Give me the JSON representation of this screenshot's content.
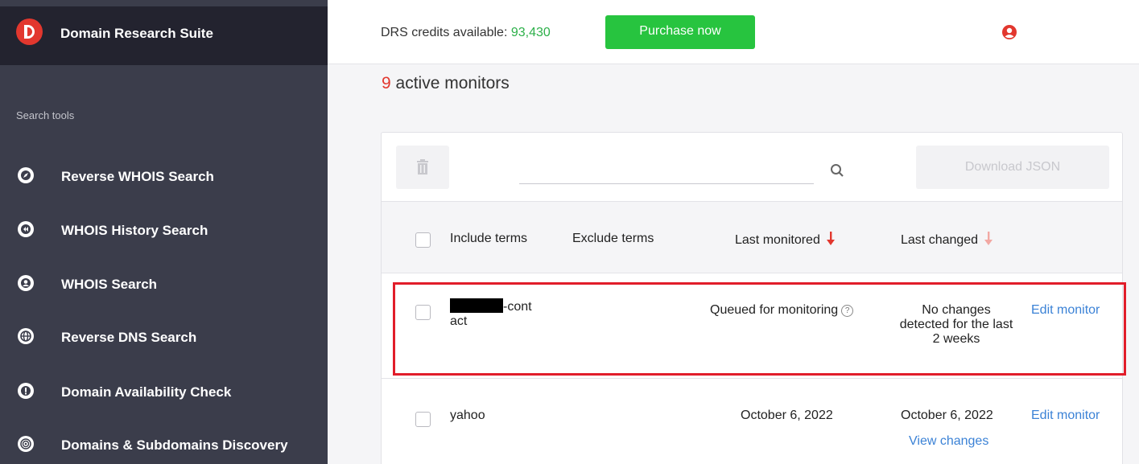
{
  "sidebar": {
    "brand": "Domain Research Suite",
    "section_label": "Search tools",
    "items": [
      {
        "label": "Reverse WHOIS Search",
        "icon": "compass-icon"
      },
      {
        "label": "WHOIS History Search",
        "icon": "rewind-icon"
      },
      {
        "label": "WHOIS Search",
        "icon": "user-circle-icon"
      },
      {
        "label": "Reverse DNS Search",
        "icon": "globe-icon"
      },
      {
        "label": "Domain Availability Check",
        "icon": "exclamation-icon"
      },
      {
        "label": "Domains & Subdomains Discovery",
        "icon": "target-icon"
      }
    ]
  },
  "topbar": {
    "credits_label": "DRS credits available: ",
    "credits_value": "93,430",
    "purchase_label": "Purchase now"
  },
  "main": {
    "active_count": "9",
    "active_label": " active monitors",
    "search_placeholder": "",
    "download_label": "Download JSON",
    "columns": {
      "include": "Include terms",
      "exclude": "Exclude terms",
      "last_monitored": "Last monitored",
      "last_changed": "Last changed"
    },
    "rows": [
      {
        "include_suffix": "-cont",
        "include_line2": "act",
        "last_monitored": "Queued for monitoring",
        "last_changed": "No changes detected for the last 2 weeks",
        "action": "Edit monitor"
      },
      {
        "include": "yahoo",
        "last_monitored": "October 6, 2022",
        "last_changed": "October 6, 2022",
        "view_changes": "View changes",
        "action": "Edit monitor"
      }
    ]
  },
  "colors": {
    "sidebar_bg": "#3b3d4b",
    "brand_bg": "#23232f",
    "accent_red": "#e2372e",
    "purchase_green": "#27c43f",
    "link_blue": "#3b82d6"
  }
}
